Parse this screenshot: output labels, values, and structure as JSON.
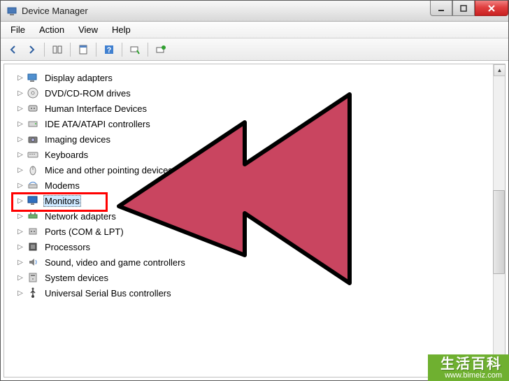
{
  "title": "Device Manager",
  "menu": {
    "file": "File",
    "action": "Action",
    "view": "View",
    "help": "Help"
  },
  "toolbar": {
    "back": "back",
    "forward": "forward",
    "show_hide_tree": "show-hide-tree",
    "properties": "properties",
    "help": "help",
    "scan": "scan",
    "update": "update"
  },
  "tree": [
    {
      "id": "display-adapters",
      "label": "Display adapters",
      "icon": "monitor-card"
    },
    {
      "id": "dvd-cdrom",
      "label": "DVD/CD-ROM drives",
      "icon": "disc"
    },
    {
      "id": "hid",
      "label": "Human Interface Devices",
      "icon": "hid"
    },
    {
      "id": "ide",
      "label": "IDE ATA/ATAPI controllers",
      "icon": "drive"
    },
    {
      "id": "imaging",
      "label": "Imaging devices",
      "icon": "camera"
    },
    {
      "id": "keyboards",
      "label": "Keyboards",
      "icon": "keyboard"
    },
    {
      "id": "mice",
      "label": "Mice and other pointing devices",
      "icon": "mouse"
    },
    {
      "id": "modems",
      "label": "Modems",
      "icon": "modem"
    },
    {
      "id": "monitors",
      "label": "Monitors",
      "icon": "monitor",
      "selected": true
    },
    {
      "id": "network",
      "label": "Network adapters",
      "icon": "network"
    },
    {
      "id": "ports",
      "label": "Ports (COM & LPT)",
      "icon": "port"
    },
    {
      "id": "processors",
      "label": "Processors",
      "icon": "cpu"
    },
    {
      "id": "sound",
      "label": "Sound, video and game controllers",
      "icon": "speaker"
    },
    {
      "id": "system",
      "label": "System devices",
      "icon": "system"
    },
    {
      "id": "usb",
      "label": "Universal Serial Bus controllers",
      "icon": "usb"
    }
  ],
  "watermark": {
    "cn": "生活百科",
    "url": "www.bimeiz.com"
  }
}
